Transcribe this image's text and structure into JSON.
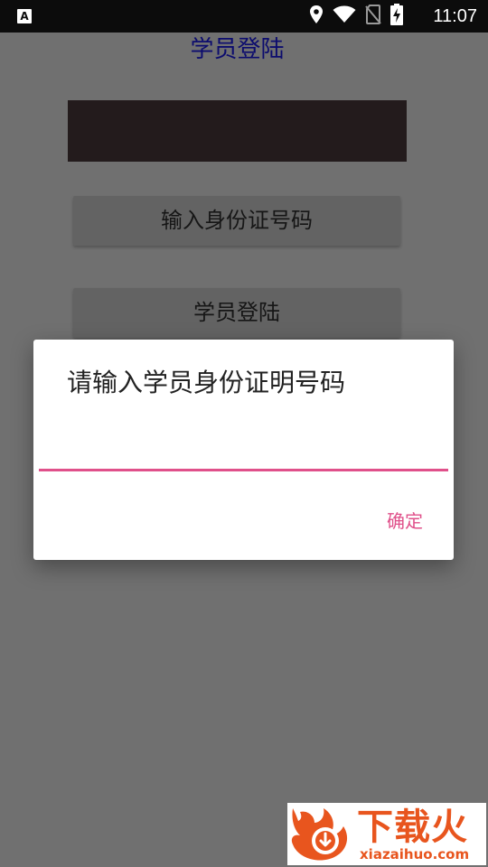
{
  "status_bar": {
    "app_badge": "A",
    "time": "11:07",
    "icons": [
      "location-icon",
      "wifi-icon",
      "no-sim-icon",
      "battery-charging-icon"
    ]
  },
  "screen": {
    "title": "学员登陆",
    "id_button_label": "输入身份证号码",
    "login_button_label": "学员登陆"
  },
  "dialog": {
    "title": "请输入学员身份证明号码",
    "input_value": "",
    "ok_label": "确定"
  },
  "watermark": {
    "title": "下载火",
    "domain": "xiazaihuo.com"
  },
  "colors": {
    "accent": "#e0508a",
    "title_text": "#0c0c6e",
    "watermark": "#e8551e"
  }
}
